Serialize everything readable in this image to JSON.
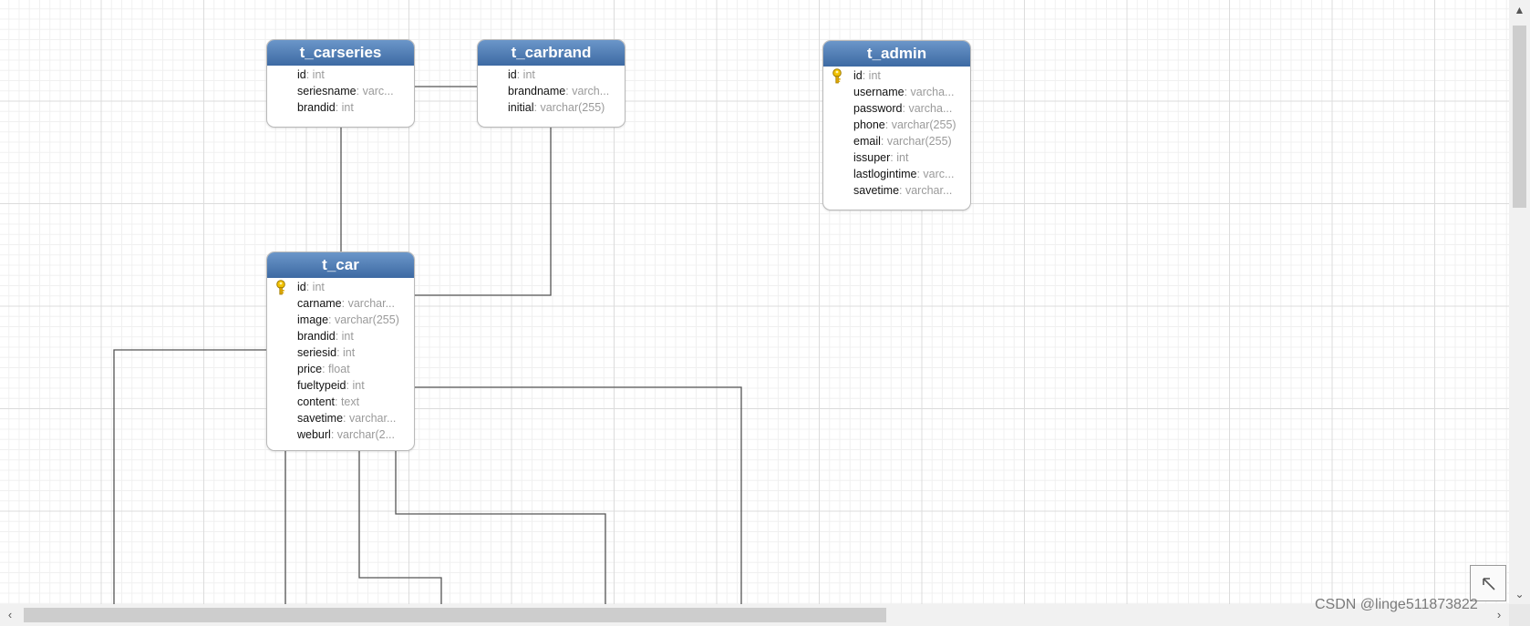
{
  "entities": {
    "carseries": {
      "title": "t_carseries",
      "fields": [
        {
          "name": "id",
          "type": ": int"
        },
        {
          "name": "seriesname",
          "type": ": varc..."
        },
        {
          "name": "brandid",
          "type": ": int"
        }
      ]
    },
    "carbrand": {
      "title": "t_carbrand",
      "fields": [
        {
          "name": "id",
          "type": ": int"
        },
        {
          "name": "brandname",
          "type": ": varch..."
        },
        {
          "name": "initial",
          "type": ": varchar(255)"
        }
      ]
    },
    "admin": {
      "title": "t_admin",
      "fields": [
        {
          "name": "id",
          "type": ": int"
        },
        {
          "name": "username",
          "type": ": varcha..."
        },
        {
          "name": "password",
          "type": ": varcha..."
        },
        {
          "name": "phone",
          "type": ": varchar(255)"
        },
        {
          "name": "email",
          "type": ": varchar(255)"
        },
        {
          "name": "issuper",
          "type": ": int"
        },
        {
          "name": "lastlogintime",
          "type": ": varc..."
        },
        {
          "name": "savetime",
          "type": ": varchar..."
        }
      ]
    },
    "car": {
      "title": "t_car",
      "fields": [
        {
          "name": "id",
          "type": ": int"
        },
        {
          "name": "carname",
          "type": ": varchar..."
        },
        {
          "name": "image",
          "type": ": varchar(255)"
        },
        {
          "name": "brandid",
          "type": ": int"
        },
        {
          "name": "seriesid",
          "type": ": int"
        },
        {
          "name": "price",
          "type": ": float"
        },
        {
          "name": "fueltypeid",
          "type": ": int"
        },
        {
          "name": "content",
          "type": ": text"
        },
        {
          "name": "savetime",
          "type": ": varchar..."
        },
        {
          "name": "weburl",
          "type": ": varchar(2..."
        }
      ]
    }
  },
  "watermark": "CSDN @linge511873822",
  "colors": {
    "header_top": "#6b96c9",
    "header_bottom": "#3d6aa3",
    "connector": "#555555",
    "key_icon": "#e8b500"
  },
  "icons": {
    "primary_key": "key-icon",
    "outline_toggle": "arrow-up-left-icon",
    "scroll_left": "chevron-left-icon",
    "scroll_right": "chevron-right-icon",
    "scroll_up": "chevron-up-icon",
    "scroll_down": "chevron-down-icon"
  }
}
